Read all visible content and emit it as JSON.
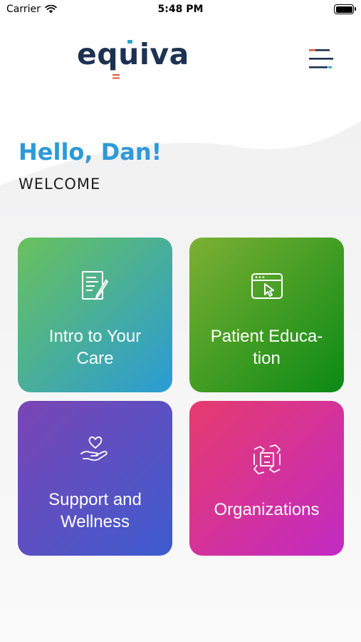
{
  "status_bar": {
    "carrier": "Carrier",
    "time": "5:48 PM"
  },
  "header": {
    "logo": "equiva",
    "menu_icon": "hamburger-menu-icon"
  },
  "greeting": {
    "hello": "Hello, Dan!",
    "welcome": "WELCOME"
  },
  "tiles": [
    {
      "label_line1": "Intro to Your",
      "label_line2": "Care",
      "icon": "document-pen-icon"
    },
    {
      "label_line1": "Patient Educa-",
      "label_line2": "tion",
      "icon": "browser-cursor-icon"
    },
    {
      "label_line1": "Support and",
      "label_line2": "Wellness",
      "icon": "heart-hand-icon"
    },
    {
      "label_line1": "Organizations",
      "icon": "linked-hands-icon"
    }
  ],
  "colors": {
    "logo": "#1d3153",
    "accent_blue": "#2d9ad8",
    "accent_red": "#e2553b",
    "tile1": [
      "#69c25c",
      "#2a9bd6"
    ],
    "tile2": [
      "#7db034",
      "#0a8a14"
    ],
    "tile3": [
      "#7b45b4",
      "#3d5ccf"
    ],
    "tile4": [
      "#e63b6e",
      "#c22ac4"
    ]
  }
}
